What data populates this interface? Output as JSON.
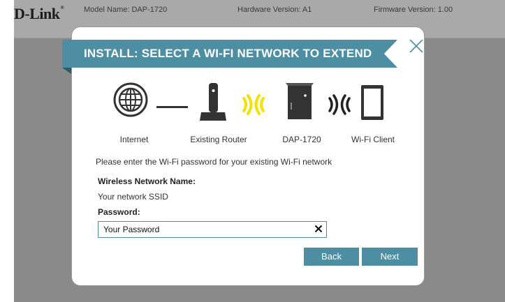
{
  "header": {
    "brand": "D-Link",
    "brand_mark": "®",
    "model": "Model Name: DAP-1720",
    "hardware": "Hardware Version: A1",
    "firmware": "Firmware Version: 1.00"
  },
  "wizard": {
    "title": "INSTALL: SELECT A WI-FI NETWORK TO EXTEND",
    "diagram": {
      "labels": [
        "Internet",
        "Existing Router",
        "DAP-1720",
        "Wi-Fi Client"
      ],
      "icons": [
        "globe-icon",
        "router-icon",
        "wifi-signal-icon",
        "extender-icon",
        "wifi-signal-icon",
        "tablet-icon"
      ]
    },
    "instruction": "Please enter the Wi-Fi password for your existing Wi-Fi network",
    "ssid_label": "Wireless Network Name:",
    "ssid_value": "Your network SSID",
    "password_label": "Password:",
    "password_value": "Your Password",
    "buttons": {
      "back": "Back",
      "next": "Next"
    }
  },
  "colors": {
    "accent": "#4d8ea3",
    "signal_active": "#f2e200",
    "signal_idle": "#222222",
    "backdrop": "#8a8a8a"
  }
}
